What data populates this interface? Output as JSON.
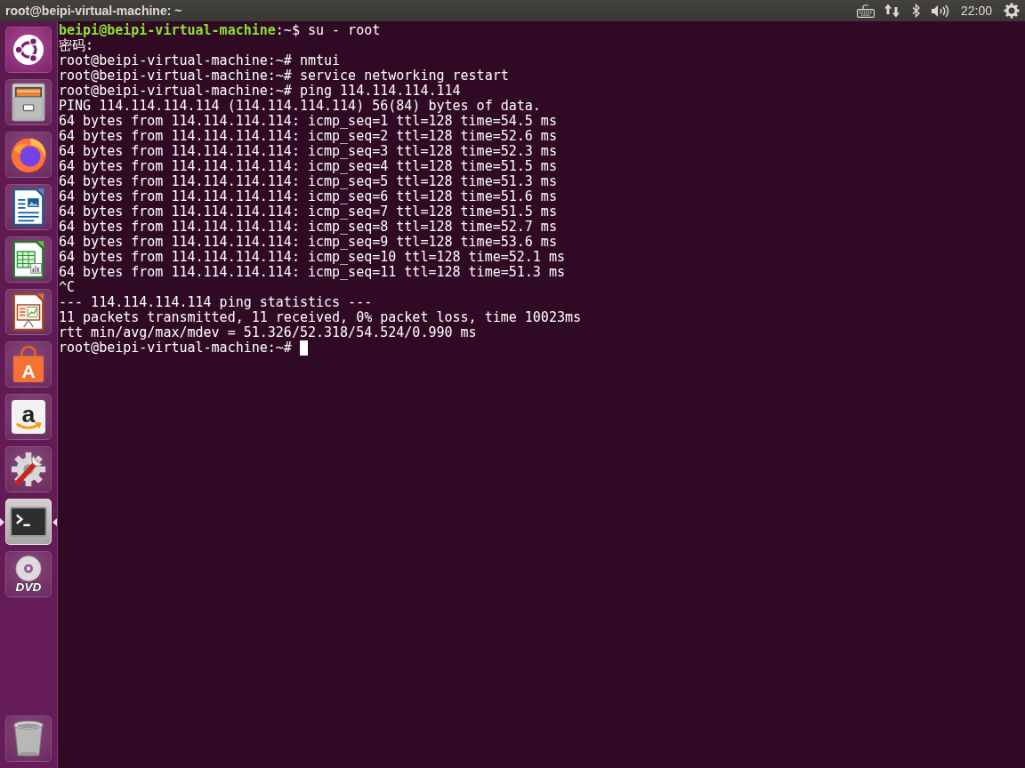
{
  "top_panel": {
    "title": "root@beipi-virtual-machine: ~",
    "clock": "22:00"
  },
  "launcher": {
    "items": [
      {
        "kind": "dash",
        "running": false,
        "focused": false
      },
      {
        "kind": "files",
        "running": false,
        "focused": false
      },
      {
        "kind": "browser",
        "running": false,
        "focused": false
      },
      {
        "kind": "writer",
        "running": false,
        "focused": false
      },
      {
        "kind": "calc",
        "running": false,
        "focused": false
      },
      {
        "kind": "impress",
        "running": false,
        "focused": false
      },
      {
        "kind": "software",
        "mark": "A",
        "running": false,
        "focused": false
      },
      {
        "kind": "amazon",
        "mark": "a",
        "running": false,
        "focused": false
      },
      {
        "kind": "settings",
        "running": false,
        "focused": false
      },
      {
        "kind": "terminal",
        "running": true,
        "focused": true
      },
      {
        "kind": "dvd",
        "mark": "DVD",
        "running": false,
        "focused": false
      }
    ],
    "bottom_items": [
      {
        "kind": "trash",
        "running": false,
        "focused": false
      }
    ]
  },
  "terminal": {
    "lines": [
      {
        "kind": "user_prompt",
        "user_host": "beipi@beipi-virtual-machine",
        "text": ":~$ su - root",
        "cursor": false
      },
      {
        "kind": "output",
        "text": "密码:",
        "cursor": false
      },
      {
        "kind": "output",
        "text": "root@beipi-virtual-machine:~# nmtui",
        "cursor": false
      },
      {
        "kind": "output",
        "text": "root@beipi-virtual-machine:~# service networking restart",
        "cursor": false
      },
      {
        "kind": "output",
        "text": "root@beipi-virtual-machine:~# ping 114.114.114.114",
        "cursor": false
      },
      {
        "kind": "output",
        "text": "PING 114.114.114.114 (114.114.114.114) 56(84) bytes of data.",
        "cursor": false
      },
      {
        "kind": "output",
        "text": "64 bytes from 114.114.114.114: icmp_seq=1 ttl=128 time=54.5 ms",
        "cursor": false
      },
      {
        "kind": "output",
        "text": "64 bytes from 114.114.114.114: icmp_seq=2 ttl=128 time=52.6 ms",
        "cursor": false
      },
      {
        "kind": "output",
        "text": "64 bytes from 114.114.114.114: icmp_seq=3 ttl=128 time=52.3 ms",
        "cursor": false
      },
      {
        "kind": "output",
        "text": "64 bytes from 114.114.114.114: icmp_seq=4 ttl=128 time=51.5 ms",
        "cursor": false
      },
      {
        "kind": "output",
        "text": "64 bytes from 114.114.114.114: icmp_seq=5 ttl=128 time=51.3 ms",
        "cursor": false
      },
      {
        "kind": "output",
        "text": "64 bytes from 114.114.114.114: icmp_seq=6 ttl=128 time=51.6 ms",
        "cursor": false
      },
      {
        "kind": "output",
        "text": "64 bytes from 114.114.114.114: icmp_seq=7 ttl=128 time=51.5 ms",
        "cursor": false
      },
      {
        "kind": "output",
        "text": "64 bytes from 114.114.114.114: icmp_seq=8 ttl=128 time=52.7 ms",
        "cursor": false
      },
      {
        "kind": "output",
        "text": "64 bytes from 114.114.114.114: icmp_seq=9 ttl=128 time=53.6 ms",
        "cursor": false
      },
      {
        "kind": "output",
        "text": "64 bytes from 114.114.114.114: icmp_seq=10 ttl=128 time=52.1 ms",
        "cursor": false
      },
      {
        "kind": "output",
        "text": "64 bytes from 114.114.114.114: icmp_seq=11 ttl=128 time=51.3 ms",
        "cursor": false
      },
      {
        "kind": "output",
        "text": "^C",
        "cursor": false
      },
      {
        "kind": "output",
        "text": "--- 114.114.114.114 ping statistics ---",
        "cursor": false
      },
      {
        "kind": "output",
        "text": "11 packets transmitted, 11 received, 0% packet loss, time 10023ms",
        "cursor": false
      },
      {
        "kind": "output",
        "text": "rtt min/avg/max/mdev = 51.326/52.318/54.524/0.990 ms",
        "cursor": false
      },
      {
        "kind": "output",
        "text": "root@beipi-virtual-machine:~#",
        "cursor": true
      }
    ]
  }
}
